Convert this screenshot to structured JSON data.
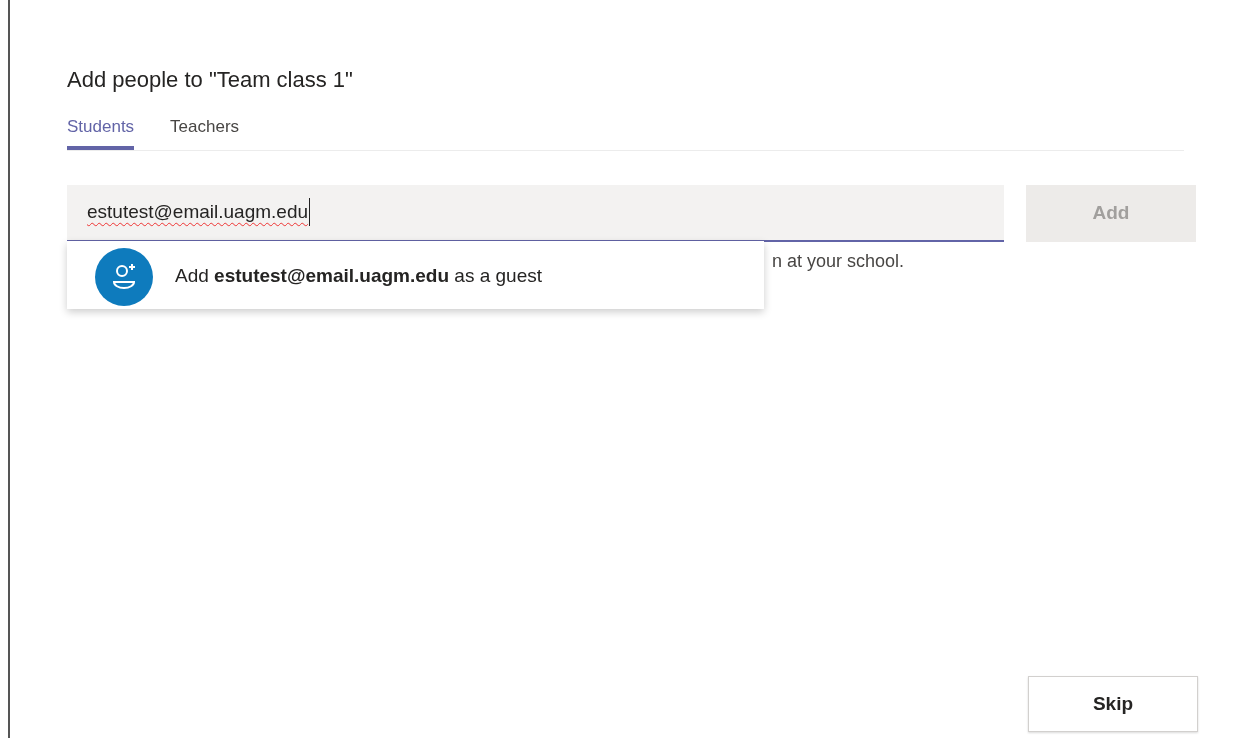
{
  "dialog": {
    "title": "Add people to \"Team class 1\""
  },
  "tabs": [
    {
      "label": "Students",
      "selected": true
    },
    {
      "label": "Teachers",
      "selected": false
    }
  ],
  "search": {
    "value": "estutest@email.uagm.edu",
    "focused": true
  },
  "add_button": {
    "label": "Add",
    "disabled": true
  },
  "helper_text": "n at your school.",
  "suggestion": {
    "text": "Add **estutest@email.uagm.edu** as a guest"
  },
  "skip_button": {
    "label": "Skip"
  }
}
